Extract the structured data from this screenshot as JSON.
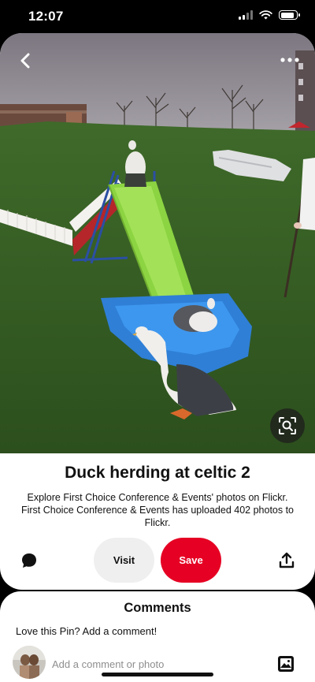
{
  "status_bar": {
    "time": "12:07",
    "battery_level": 0.85
  },
  "pin": {
    "title": "Duck herding at celtic 2",
    "description": "Explore First Choice Conference & Events' photos on Flickr. First Choice Conference & Events has uploaded 402 photos to Flickr."
  },
  "actions": {
    "visit_label": "Visit",
    "save_label": "Save"
  },
  "comments": {
    "heading": "Comments",
    "prompt": "Love this Pin? Add a comment!",
    "input_placeholder": "Add a comment or photo"
  },
  "colors": {
    "save": "#e60023",
    "visit": "#efefef",
    "lens_button": "#1e1e1e"
  },
  "icons": [
    "back-arrow-icon",
    "more-dots-icon",
    "visual-search-icon",
    "comment-bubble-icon",
    "share-icon",
    "photo-icon"
  ]
}
